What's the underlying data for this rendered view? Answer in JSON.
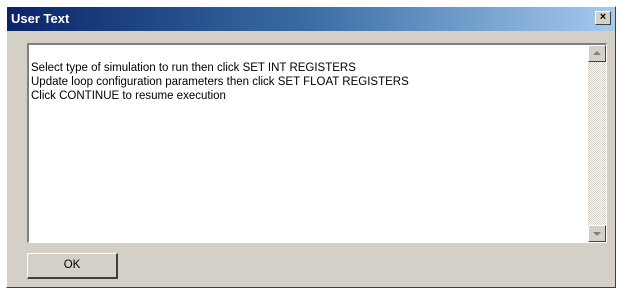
{
  "window": {
    "title": "User Text",
    "close_label": "×"
  },
  "message": {
    "lines": [
      "Select type of simulation to run then click SET INT REGISTERS",
      "Update loop configuration parameters then click SET FLOAT REGISTERS",
      "Click CONTINUE to resume execution"
    ]
  },
  "buttons": {
    "ok_label": "OK"
  },
  "icons": {
    "close": "close-icon",
    "scroll_up": "scroll-up-arrow-icon",
    "scroll_down": "scroll-down-arrow-icon"
  },
  "colors": {
    "titlebar_start": "#0a246a",
    "titlebar_end": "#a6caf0",
    "face": "#d4d0c8"
  }
}
